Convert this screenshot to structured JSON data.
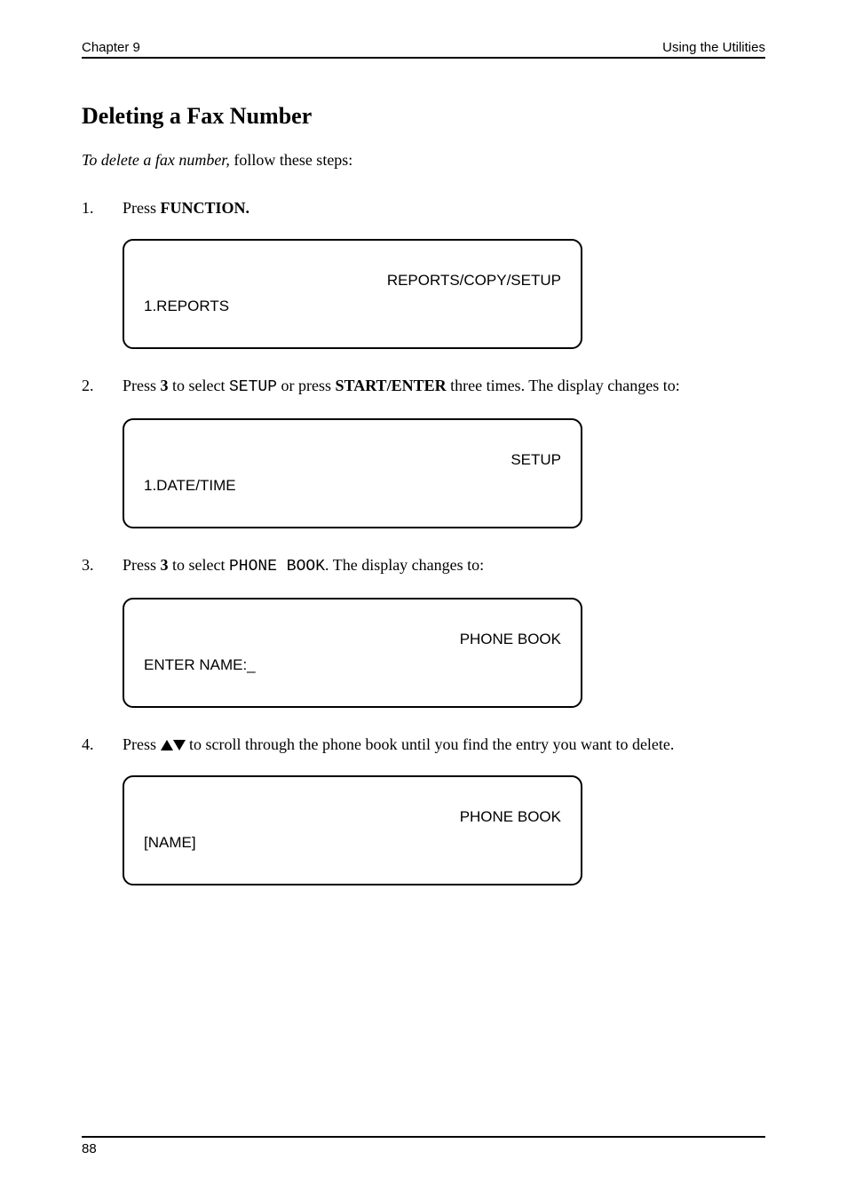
{
  "header": {
    "left": "Chapter 9",
    "right": "Using the Utilities"
  },
  "section_title": "Deleting a Fax Number",
  "intro": {
    "lead": "To delete a fax number, ",
    "follow": "follow these steps:"
  },
  "steps": [
    {
      "num": "1.",
      "parts": [
        {
          "text": "Press "
        },
        {
          "text": "FUNCTION.",
          "bold": true
        }
      ],
      "lcd": {
        "line1": "REPORTS/COPY/SETUP",
        "line2": "1.REPORTS"
      }
    },
    {
      "num": "2.",
      "parts": [
        {
          "text": "Press "
        },
        {
          "text": "3",
          "bold": true
        },
        {
          "text": " to select "
        },
        {
          "text": "SETUP",
          "code": true
        },
        {
          "text": " or press "
        },
        {
          "text": "START/ENTER",
          "bold": true
        },
        {
          "text": " three times. The display changes to:"
        }
      ],
      "lcd": {
        "line1": "SETUP",
        "line2": "1.DATE/TIME"
      }
    },
    {
      "num": "3.",
      "parts": [
        {
          "text": "Press "
        },
        {
          "text": "3",
          "bold": true
        },
        {
          "text": " to select "
        },
        {
          "text": "PHONE BOOK",
          "code": true
        },
        {
          "text": ". The display changes to:"
        }
      ],
      "lcd": {
        "line1": "PHONE BOOK",
        "line2": "ENTER NAME:_"
      }
    },
    {
      "num": "4.",
      "parts": [
        {
          "text": "Press "
        },
        {
          "text": "▲▼",
          "bold": true
        },
        {
          "text": " to scroll through the phone book until you find the entry you want to delete."
        }
      ],
      "lcd": {
        "line1": "PHONE BOOK",
        "line2": "[NAME]"
      }
    }
  ],
  "footer": {
    "page_number": "88"
  }
}
